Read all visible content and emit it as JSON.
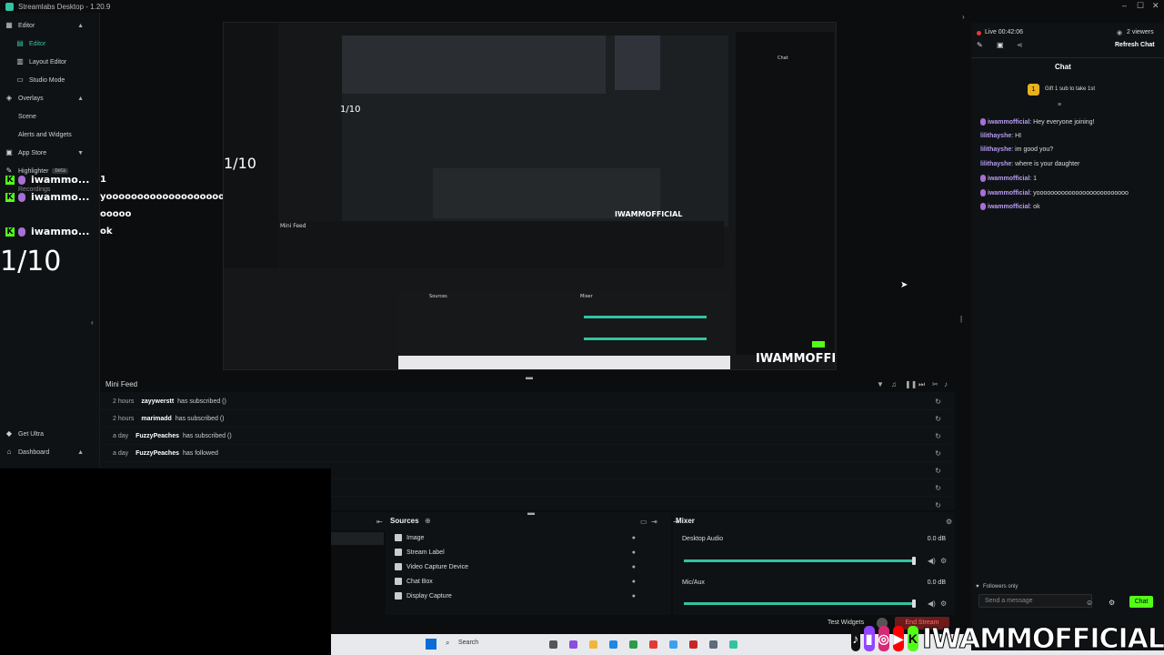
{
  "window": {
    "title": "Streamlabs Desktop - 1.20.9",
    "controls": [
      "–",
      "☐",
      "✕"
    ]
  },
  "sidebar": {
    "items": [
      {
        "label": "Editor",
        "type": "section"
      },
      {
        "label": "Editor",
        "type": "sub",
        "active": true
      },
      {
        "label": "Layout Editor",
        "type": "sub"
      },
      {
        "label": "Studio Mode",
        "type": "sub"
      },
      {
        "label": "Overlays",
        "type": "section"
      },
      {
        "label": "Scene",
        "type": "sub"
      },
      {
        "label": "Alerts and Widgets",
        "type": "sub"
      },
      {
        "label": "App Store",
        "type": "section"
      },
      {
        "label": "Highlighter",
        "type": "section",
        "badge": "beta"
      },
      {
        "label": "Recordings",
        "type": "sub"
      },
      {
        "label": "Get Ultra",
        "type": "section"
      },
      {
        "label": "Dashboard",
        "type": "section"
      }
    ]
  },
  "overlay_chat": {
    "user1": "iwammo...",
    "user2": "iwammo...",
    "msg1": "1",
    "msg2": "yoooooooooooooooooooooo",
    "msg3": "ooooo",
    "user3": "iwammo...",
    "msg4": "ok",
    "rating": "1/10"
  },
  "preview": {
    "rating_small": "1/10",
    "rating_mid": "1/10",
    "brand_small": "IWAMMOFFICIAL",
    "brand_mid": "IWAMMOFFICIAL",
    "nested_feed_title": "Mini Feed",
    "nested_sources": "Sources",
    "nested_mixer": "Mixer",
    "nested_chat": "Chat"
  },
  "minifeed": {
    "title": "Mini Feed",
    "rows": [
      {
        "time": "2 hours",
        "user": "zayywerstt",
        "action": "has subscribed ()"
      },
      {
        "time": "2 hours",
        "user": "marimadd",
        "action": "has subscribed ()"
      },
      {
        "time": "a day",
        "user": "FuzzyPeaches",
        "action": "has subscribed ()"
      },
      {
        "time": "a day",
        "user": "FuzzyPeaches",
        "action": "has followed"
      }
    ]
  },
  "sources": {
    "title": "Sources",
    "items": [
      "Image",
      "Stream Label",
      "Video Capture Device",
      "Chat Box",
      "Display Capture"
    ]
  },
  "mixer": {
    "title": "Mixer",
    "channels": [
      {
        "name": "Desktop Audio",
        "db": "0.0 dB",
        "level": 1.0
      },
      {
        "name": "Mic/Aux",
        "db": "0.0 dB",
        "level": 1.0
      }
    ]
  },
  "bottombar": {
    "test_widgets": "Test Widgets",
    "end_stream": "End Stream"
  },
  "taskbar": {
    "search": "Search"
  },
  "right_panel": {
    "live": "Live 00:42:06",
    "viewers": "2 viewers",
    "refresh": "Refresh Chat",
    "chat_title": "Chat",
    "gift": "Gift 1 sub to take 1st",
    "messages": [
      {
        "user": "iwammofficial",
        "text": ": Hey everyone joining!"
      },
      {
        "user": "lilithayshe",
        "text": ": HI"
      },
      {
        "user": "lilithayshe",
        "text": ": im good you?"
      },
      {
        "user": "lilithayshe",
        "text": ": where is your daughter"
      },
      {
        "user": "iwammofficial",
        "text": ": 1"
      },
      {
        "user": "iwammofficial",
        "text": ": yoooooooooooooooooooooooooo"
      },
      {
        "user": "iwammofficial",
        "text": ": ok"
      }
    ],
    "followers_only": "Followers only",
    "input_placeholder": "Send a message",
    "send_label": "Chat"
  },
  "brand": {
    "text": "IWAMMOFFICIAL"
  },
  "colors": {
    "accent": "#31c3a2",
    "kick": "#53fc18",
    "chat_user": "#b79cf2"
  }
}
